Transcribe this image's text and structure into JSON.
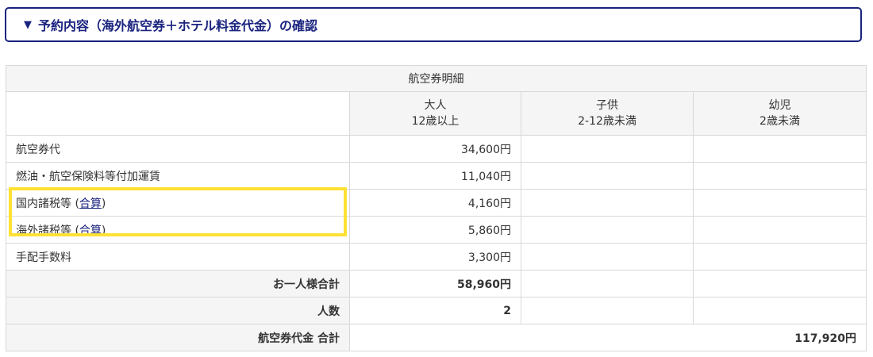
{
  "section": {
    "triangle": "▼",
    "title": "予約内容（海外航空券＋ホテル料金代金）の確認"
  },
  "table": {
    "title": "航空券明細",
    "columns": [
      {
        "line1": "大人",
        "line2": "12歳以上"
      },
      {
        "line1": "子供",
        "line2": "2-12歳未満"
      },
      {
        "line1": "幼児",
        "line2": "2歳未満"
      }
    ],
    "rows": [
      {
        "label": "航空券代",
        "adult": "34,600円"
      },
      {
        "label": "燃油・航空保険料等付加運賃",
        "adult": "11,040円"
      },
      {
        "label_prefix": "国内諸税等 (",
        "link": "合算",
        "label_suffix": ")",
        "adult": "4,160円"
      },
      {
        "label_prefix": "海外諸税等 (",
        "link": "合算",
        "label_suffix": ")",
        "adult": "5,860円"
      },
      {
        "label": "手配手数料",
        "adult": "3,300円"
      }
    ],
    "per_person": {
      "label": "お一人様合計",
      "adult": "58,960円"
    },
    "count": {
      "label": "人数",
      "adult": "2"
    },
    "grand_total": {
      "label": "航空券代金 合計",
      "value": "117,920円"
    }
  },
  "highlight_color": "#ffe135"
}
